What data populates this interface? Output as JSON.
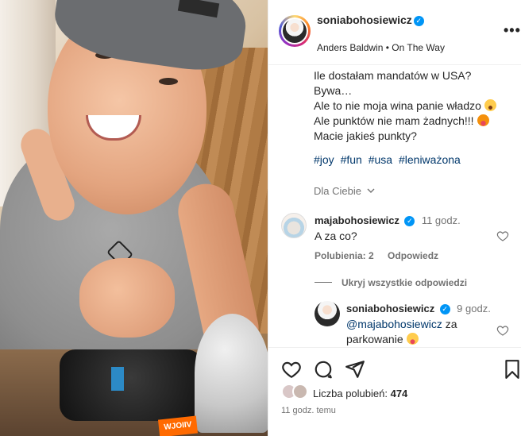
{
  "post": {
    "username": "soniabohosiewicz",
    "verified_mark": "✓",
    "audio": "Anders Baldwin • On The Way",
    "more_label": "•••",
    "caption_lines": [
      "Ile dostałam mandatów w USA?",
      "Bywa…",
      "Ale to nie moja wina panie władzo",
      "Ale punktów nie mam żadnych!!!",
      "Macie jakieś punkty?"
    ],
    "hashtags": [
      "#joy",
      "#fun",
      "#usa",
      "#leniważona"
    ],
    "translate_label": "Dla Ciebie",
    "photo_sticker": "WJOIIV"
  },
  "comments": [
    {
      "username": "majabohosiewicz",
      "time": "11 godz.",
      "text": "A za co?",
      "likes_label": "Polubienia: 2",
      "reply_label": "Odpowiedz"
    }
  ],
  "hide_replies_label": "Ukryj wszystkie odpowiedzi",
  "reply": {
    "username": "soniabohosiewicz",
    "time": "9 godz.",
    "mention": "@majabohosiewicz",
    "text": "za parkowanie"
  },
  "footer": {
    "likes_label": "Liczba polubień:",
    "likes_count": "474",
    "timestamp": "11 godz. temu"
  },
  "colors": {
    "verified": "#0095f6",
    "link": "#00376b",
    "muted": "#737373"
  },
  "icons": [
    "heart-icon",
    "comment-icon",
    "share-icon",
    "bookmark-icon",
    "more-icon",
    "verified-badge-icon",
    "chevron-down-icon"
  ]
}
